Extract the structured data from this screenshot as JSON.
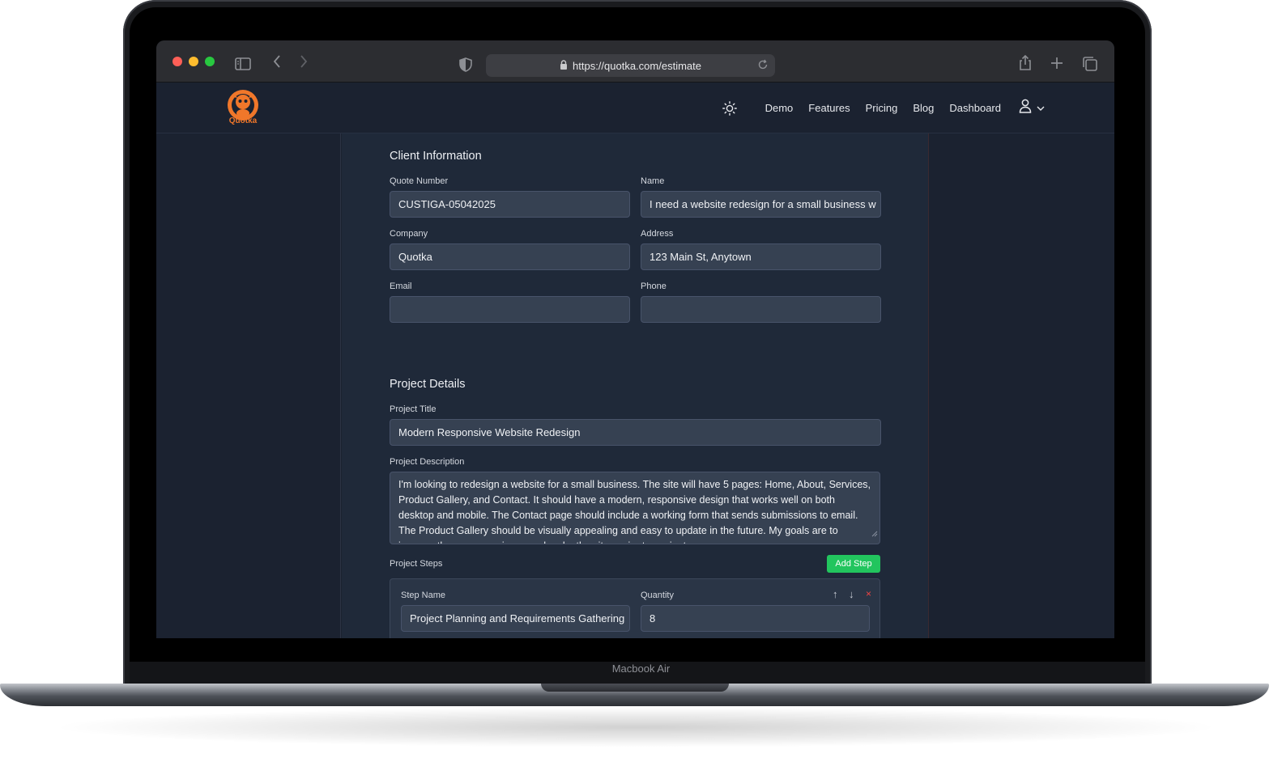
{
  "device": {
    "label": "Macbook Air"
  },
  "browser": {
    "url": "https://quotka.com/estimate",
    "icons": [
      "sidebar-toggle-icon",
      "back-icon",
      "forward-icon",
      "shield-icon",
      "lock-icon",
      "reload-icon",
      "share-icon",
      "new-tab-icon",
      "tabs-overview-icon"
    ]
  },
  "nav": {
    "logo_text": "Quotka",
    "items": [
      {
        "label": "Demo"
      },
      {
        "label": "Features"
      },
      {
        "label": "Pricing"
      },
      {
        "label": "Blog"
      },
      {
        "label": "Dashboard"
      }
    ]
  },
  "client": {
    "title": "Client Information",
    "quote_number": {
      "label": "Quote Number",
      "value": "CUSTIGA-05042025"
    },
    "name": {
      "label": "Name",
      "value": "I need a website redesign for a small business w"
    },
    "company": {
      "label": "Company",
      "value": "Quotka"
    },
    "address": {
      "label": "Address",
      "value": "123 Main St, Anytown"
    },
    "email": {
      "label": "Email",
      "value": ""
    },
    "phone": {
      "label": "Phone",
      "value": ""
    }
  },
  "project": {
    "title": "Project Details",
    "project_title": {
      "label": "Project Title",
      "value": "Modern Responsive Website Redesign"
    },
    "description": {
      "label": "Project Description",
      "value": "I'm looking to redesign a website for a small business. The site will have 5 pages: Home, About, Services, Product Gallery, and Contact. It should have a modern, responsive design that works well on both desktop and mobile. The Contact page should include a working form that sends submissions to email. The Product Gallery should be visually appealing and easy to update in the future. My goals are to improve the user experience and make the site easier to navigate."
    },
    "steps_label": "Project Steps",
    "add_step_label": "Add Step",
    "steps": [
      {
        "name_label": "Step Name",
        "name": "Project Planning and Requirements Gathering",
        "quantity_label": "Quantity",
        "quantity": "8",
        "move_up": "↑",
        "move_down": "↓",
        "remove": "×"
      }
    ]
  },
  "colors": {
    "accent_green": "#22c55e",
    "brand_orange": "#f0772a",
    "remove_red": "#ef4444",
    "background": "#1b2230"
  }
}
